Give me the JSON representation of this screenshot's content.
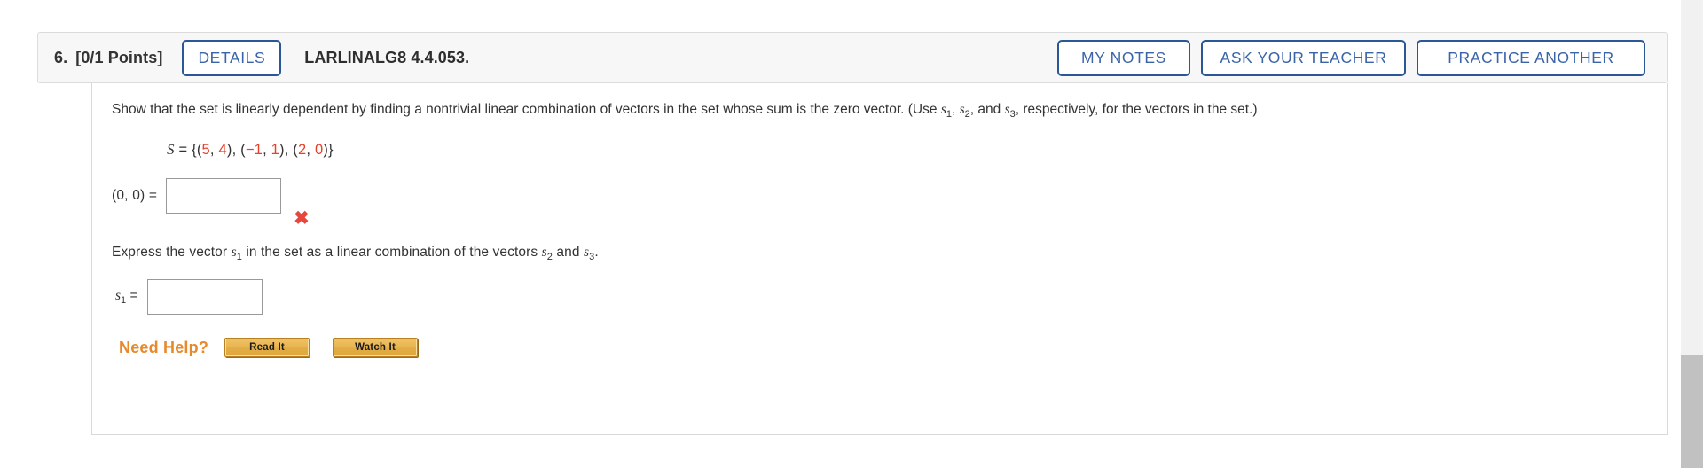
{
  "question": {
    "number": "6.",
    "points": "[0/1 Points]",
    "details_label": "DETAILS",
    "textbook_code": "LARLINALG8 4.4.053."
  },
  "header_actions": {
    "my_notes": "MY NOTES",
    "ask_your_teacher": "ASK YOUR TEACHER",
    "practice_another": "PRACTICE ANOTHER"
  },
  "prompt": {
    "part1": "Show that the set is linearly dependent by finding a nontrivial linear combination of vectors in the set whose sum is the zero vector. (Use ",
    "var1": "s",
    "var1_sub": "1",
    "sep1": ", ",
    "var2": "s",
    "var2_sub": "2",
    "sep2": ", and ",
    "var3": "s",
    "var3_sub": "3",
    "part2": ",  respectively, for the vectors in the set.)"
  },
  "set_definition": {
    "symbol": "S",
    "equals": " = ",
    "open": "{(",
    "v1x": "5",
    "v1_comma": ", ",
    "v1y": "4",
    "between1": "), (",
    "v2x": "−1",
    "v2_comma": ", ",
    "v2y": "1",
    "between2": "), (",
    "v3x": "2",
    "v3_comma": ", ",
    "v3y": "0",
    "close": ")}"
  },
  "answer1": {
    "label": "(0, 0) =",
    "value": "",
    "status_icon": "✖",
    "status_icon_name": "incorrect-x-icon",
    "status_color": "#e8453c"
  },
  "prompt2": {
    "part1": "Express the vector ",
    "var1": "s",
    "var1_sub": "1",
    "part2": " in the set as a linear combination of the vectors ",
    "var2": "s",
    "var2_sub": "2",
    "part3": " and ",
    "var3": "s",
    "var3_sub": "3",
    "part4": "."
  },
  "answer2": {
    "label_var": "s",
    "label_sub": "1",
    "label_eq": " =",
    "value": ""
  },
  "help": {
    "title": "Need Help?",
    "read_it": "Read It",
    "watch_it": "Watch It"
  },
  "colors": {
    "accent_blue": "#3a63a8",
    "border_blue": "#2b5797",
    "number_red": "#e8402a",
    "help_orange": "#e8892b",
    "header_bg": "#f7f7f7"
  }
}
